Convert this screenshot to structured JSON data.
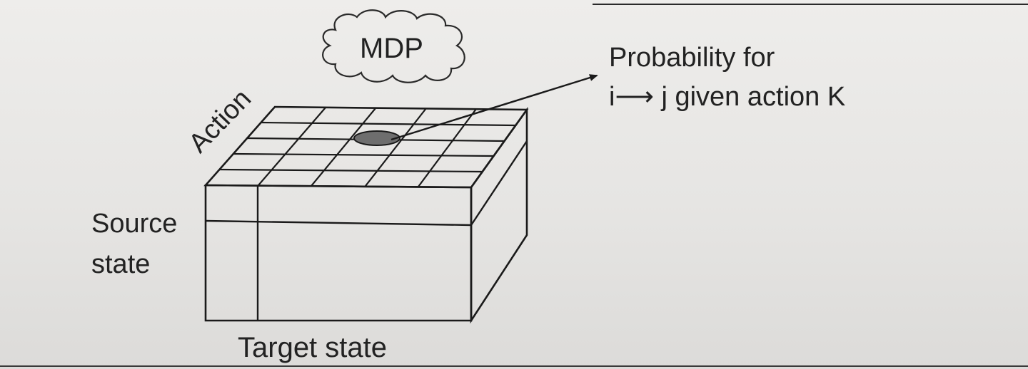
{
  "diagram": {
    "cloud_label": "MDP",
    "probability_label": {
      "line1": "Probability for",
      "line2": "i⟶ j given action K"
    },
    "action_axis_label": "Action",
    "source_axis_label": {
      "line1": "Source",
      "line2": "state"
    },
    "target_axis_label": "Target state"
  }
}
